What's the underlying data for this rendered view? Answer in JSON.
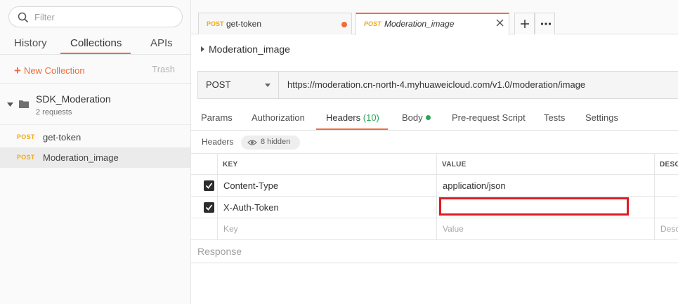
{
  "sidebar": {
    "filter_placeholder": "Filter",
    "tabs": [
      {
        "label": "History"
      },
      {
        "label": "Collections"
      },
      {
        "label": "APIs"
      }
    ],
    "new_collection_label": "New Collection",
    "trash_label": "Trash",
    "collection": {
      "name": "SDK_Moderation",
      "count": "2 requests",
      "requests": [
        {
          "method": "POST",
          "name": "get-token"
        },
        {
          "method": "POST",
          "name": "Moderation_image"
        }
      ]
    }
  },
  "tabs": [
    {
      "method": "POST",
      "name": "get-token"
    },
    {
      "method": "POST",
      "name": "Moderation_image"
    }
  ],
  "request": {
    "title": "Moderation_image",
    "method": "POST",
    "url": "https://moderation.cn-north-4.myhuaweicloud.com/v1.0/moderation/image"
  },
  "request_tabs": {
    "params": "Params",
    "authorization": "Authorization",
    "headers": "Headers",
    "headers_count": "(10)",
    "body": "Body",
    "prerequest": "Pre-request Script",
    "tests": "Tests",
    "settings": "Settings"
  },
  "headers_section": {
    "label": "Headers",
    "hidden_label": "8 hidden"
  },
  "headers_table": {
    "columns": {
      "key": "KEY",
      "value": "VALUE",
      "description": "DESCI"
    },
    "rows": [
      {
        "key": "Content-Type",
        "value": "application/json",
        "checked": true
      },
      {
        "key": "X-Auth-Token",
        "value": "",
        "checked": true
      }
    ],
    "placeholder": {
      "key": "Key",
      "value": "Value",
      "description": "Desc"
    }
  },
  "response": {
    "label": "Response"
  },
  "colors": {
    "accent": "#f26b3a",
    "post_method": "#f4a818",
    "success": "#2ca55a",
    "highlight_box": "#e01a22"
  }
}
